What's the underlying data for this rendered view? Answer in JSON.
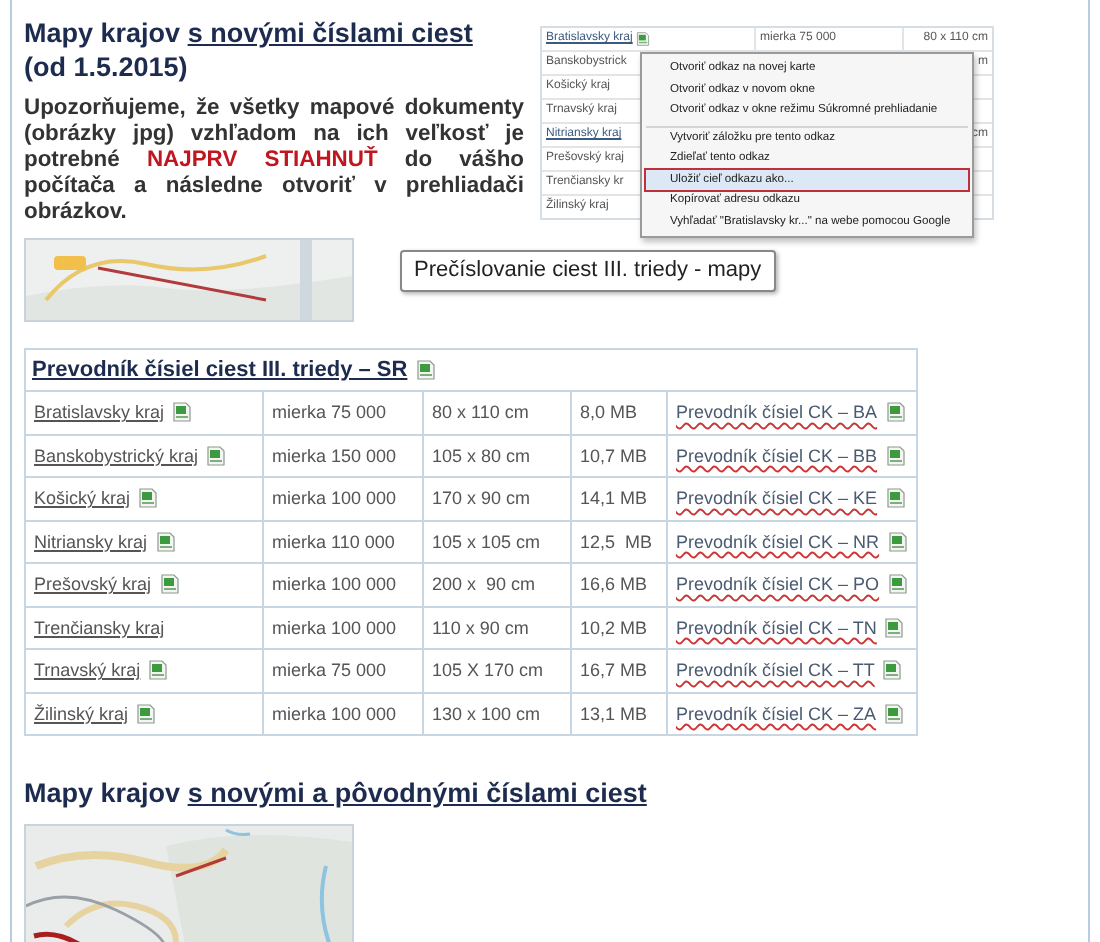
{
  "header": {
    "title": "Mapy krajov",
    "link": "s novými číslami ciest",
    "date": "(od 1.5.2015)"
  },
  "notice": {
    "before": "Upozorňujeme, že všetky mapové dokumenty (obrázky jpg) vzhľadom na ich veľkosť je potrebné",
    "warning": "NAJPRV STIAHNUŤ",
    "after": "do vášho počítača a následne otvoriť v prehliadači obrázkov."
  },
  "embedded_screenshot": {
    "rows": [
      {
        "region": "Bratislavsky kraj",
        "link": true,
        "icon": true,
        "scale": "mierka 75 000",
        "size": "80 x 110 cm"
      },
      {
        "region": "Banskobystrick",
        "link": false,
        "icon": false,
        "size": "m"
      },
      {
        "region": "Košický kraj",
        "link": false,
        "icon": false
      },
      {
        "region": "Trnavský kraj",
        "link": false,
        "icon": false
      },
      {
        "region": "Nitriansky kraj",
        "link": true,
        "icon": false,
        "size": "cm"
      },
      {
        "region": "Prešovský kraj",
        "link": false,
        "icon": false
      },
      {
        "region": "Trenčiansky kr",
        "link": false,
        "icon": false
      },
      {
        "region": "Žilinský kraj",
        "link": false,
        "icon": false
      }
    ],
    "context_menu": [
      {
        "label": "Otvoriť odkaz na novej karte",
        "selected": false,
        "separator_before": false
      },
      {
        "label": "Otvoriť odkaz v novom okne",
        "selected": false,
        "separator_before": false
      },
      {
        "label": "Otvoriť odkaz v okne režimu Súkromné prehliadanie",
        "selected": false,
        "separator_before": false
      },
      {
        "label": "Vytvoriť záložku pre tento odkaz",
        "selected": false,
        "separator_before": true
      },
      {
        "label": "Zdieľať tento odkaz",
        "selected": false,
        "separator_before": false
      },
      {
        "label": "Uložiť cieľ odkazu ako...",
        "selected": true,
        "separator_before": false
      },
      {
        "label": "Kopírovať adresu odkazu",
        "selected": false,
        "separator_before": false
      },
      {
        "label": "Vyhľadať \"Bratislavsky kr...\" na webe pomocou Google",
        "selected": false,
        "separator_before": false
      }
    ]
  },
  "tooltip": "Prečíslovanie ciest III. triedy - mapy",
  "table": {
    "title": "Prevodník čísiel ciest III. triedy – SR",
    "rows": [
      {
        "region": "Bratislavsky kraj",
        "icon": true,
        "scale": "mierka 75 000",
        "size": "80 x 110 cm",
        "file_size": "8,0 MB",
        "converter": "Prevodník čísiel CK – BA"
      },
      {
        "region": "Banskobystrický kraj",
        "icon": true,
        "scale": "mierka 150 000",
        "size": "105 x 80 cm",
        "file_size": "10,7 MB",
        "converter": "Prevodník čísiel CK – BB"
      },
      {
        "region": "Košický kraj",
        "icon": true,
        "scale": "mierka 100 000",
        "size": "170 x 90 cm",
        "file_size": "14,1 MB",
        "converter": "Prevodník čísiel CK – KE"
      },
      {
        "region": "Nitriansky kraj",
        "icon": true,
        "scale": "mierka 110 000",
        "size": "105 x 105 cm",
        "file_size": "12,5  MB",
        "converter": "Prevodník čísiel CK – NR"
      },
      {
        "region": "Prešovský kraj",
        "icon": true,
        "scale": "mierka 100 000",
        "size": "200 x  90 cm",
        "file_size": "16,6 MB",
        "converter": "Prevodník čísiel CK – PO"
      },
      {
        "region": "Trenčiansky kraj",
        "icon": false,
        "scale": "mierka 100 000",
        "size": "110 x 90 cm",
        "file_size": "10,2 MB",
        "converter": "Prevodník čísiel CK – TN"
      },
      {
        "region": "Trnavský kraj",
        "icon": true,
        "scale": "mierka 75 000",
        "size": "105 X 170 cm",
        "file_size": "16,7 MB",
        "converter": "Prevodník čísiel CK – TT"
      },
      {
        "region": "Žilinský kraj",
        "icon": true,
        "scale": "mierka 100 000",
        "size": "130 x 100 cm",
        "file_size": "13,1 MB",
        "converter": "Prevodník čísiel CK – ZA"
      }
    ]
  },
  "section2": {
    "title": "Mapy krajov",
    "link": "s novými a pôvodnými číslami ciest"
  }
}
